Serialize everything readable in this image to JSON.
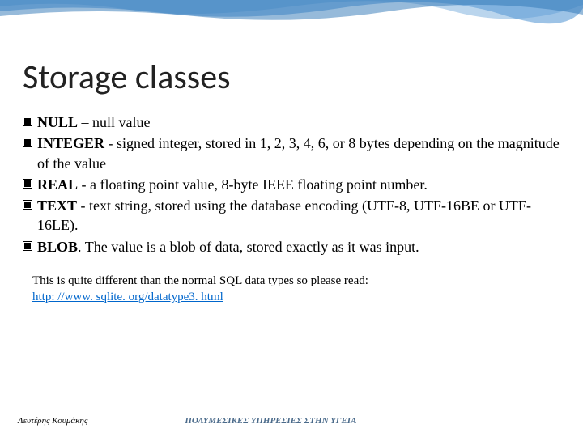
{
  "decoration": {
    "wave_color1": "#5b9bd5",
    "wave_color2": "#2e75b6",
    "wave_color3": "#9dc3e6"
  },
  "title": "Storage classes",
  "bullets": [
    {
      "bold": "NULL",
      "rest": " – null value"
    },
    {
      "bold": "INTEGER",
      "rest": " - signed integer, stored in 1, 2, 3, 4, 6, or 8 bytes depending on the magnitude of the value"
    },
    {
      "bold": "REAL",
      "rest": " - a floating point value,  8-byte IEEE floating point number."
    },
    {
      "bold": "TEXT",
      "rest": " - text string, stored using the database encoding (UTF-8, UTF-16BE or UTF-16LE)."
    },
    {
      "bold": "BLOB",
      "rest": ". The value is a blob of data, stored exactly as it was input."
    }
  ],
  "note": {
    "text": "This is quite different than the normal SQL data types so please read:",
    "link": "http: //www. sqlite. org/datatype3. html"
  },
  "footer": {
    "left": "Λευτέρης Κουμάκης",
    "center": "ΠΟΛΥΜΕΣΙΚΕΣ ΥΠΗΡΕΣΙΕΣ ΣΤΗΝ ΥΓΕΙΑ"
  }
}
